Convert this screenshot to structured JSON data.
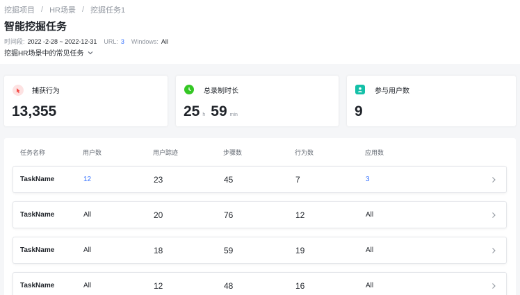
{
  "breadcrumb": {
    "items": [
      "挖掘项目",
      "HR场景",
      "挖掘任务1"
    ],
    "separator": "/"
  },
  "header": {
    "title": "智能挖掘任务",
    "time_label": "时间段:",
    "time_value": "2022 -2-28 ~ 2022-12-31",
    "url_label": "URL:",
    "url_value": "3",
    "windows_label": "Windows:",
    "windows_value": "All",
    "description": "挖掘HR场景中的常见任务"
  },
  "stats": {
    "actions": {
      "label": "捕获行为",
      "value": "13,355",
      "icon": "cursor-click-icon",
      "color": "#f54a45",
      "bg": "#fde2e2"
    },
    "duration": {
      "label": "总录制时长",
      "hours": "25",
      "hours_unit": "h",
      "minutes": "59",
      "minutes_unit": "min",
      "icon": "clock-icon",
      "color": "#34c724",
      "bg": "#34c724"
    },
    "users": {
      "label": "参与用户数",
      "value": "9",
      "icon": "user-icon",
      "color": "#14c0a8",
      "bg": "#14c0a8"
    }
  },
  "table": {
    "columns": [
      "任务名称",
      "用户数",
      "用户踪迹",
      "步骤数",
      "行为数",
      "应用数"
    ],
    "rows": [
      {
        "name": "TaskName",
        "users": "12",
        "traces": "23",
        "steps": "45",
        "actions": "7",
        "apps": "3",
        "users_link": true,
        "apps_link": true
      },
      {
        "name": "TaskName",
        "users": "All",
        "traces": "20",
        "steps": "76",
        "actions": "12",
        "apps": "All",
        "users_link": false,
        "apps_link": false
      },
      {
        "name": "TaskName",
        "users": "All",
        "traces": "18",
        "steps": "59",
        "actions": "19",
        "apps": "All",
        "users_link": false,
        "apps_link": false
      },
      {
        "name": "TaskName",
        "users": "All",
        "traces": "12",
        "steps": "48",
        "actions": "16",
        "apps": "All",
        "users_link": false,
        "apps_link": false
      }
    ]
  },
  "colors": {
    "link": "#3370ff",
    "text": "#1f2329",
    "muted": "#8f959e"
  }
}
